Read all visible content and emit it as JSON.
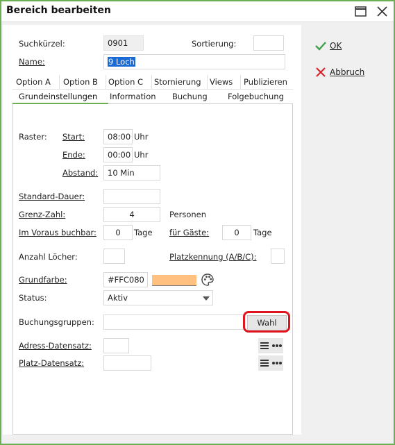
{
  "window": {
    "title": "Bereich bearbeiten"
  },
  "form": {
    "suchkuerzel_label": "Suchkürzel:",
    "suchkuerzel_value": "0901",
    "sortierung_label": "Sortierung:",
    "sortierung_value": "",
    "name_label": "Name:",
    "name_value": "9 Loch"
  },
  "tabs_row1": [
    "Option A",
    "Option B",
    "Option C",
    "Stornierung",
    "Views",
    "Publizieren"
  ],
  "tabs_row2": [
    "Grundeinstellungen",
    "Information",
    "Buchung",
    "Folgebuchung"
  ],
  "active_tab": "Grundeinstellungen",
  "grund": {
    "raster_label": "Raster:",
    "start_label": "Start:",
    "start_value": "08:00",
    "start_unit": "Uhr",
    "ende_label": "Ende:",
    "ende_value": "00:00",
    "ende_unit": "Uhr",
    "abstand_label": "Abstand:",
    "abstand_value": "10 Min",
    "standard_dauer_label": "Standard-Dauer:",
    "standard_dauer_value": "",
    "grenz_zahl_label": "Grenz-Zahl:",
    "grenz_zahl_value": "4",
    "grenz_zahl_unit": "Personen",
    "im_voraus_label": "Im Voraus buchbar:",
    "im_voraus_value": "0",
    "im_voraus_unit": "Tage",
    "fuer_gaeste_label": "für Gäste:",
    "fuer_gaeste_value": "0",
    "fuer_gaeste_unit": "Tage",
    "anzahl_loecher_label": "Anzahl Löcher:",
    "anzahl_loecher_value": "",
    "platzkennung_label": "Platzkennung (A/B/C):",
    "platzkennung_value": "",
    "grundfarbe_label": "Grundfarbe:",
    "grundfarbe_value": "#FFC080",
    "status_label": "Status:",
    "status_value": "Aktiv",
    "buchungsgruppen_label": "Buchungsgruppen:",
    "buchungsgruppen_value": "",
    "wahl_label": "Wahl",
    "adress_label": "Adress-Datensatz:",
    "adress_value": "",
    "platz_label": "Platz-Datensatz:",
    "platz_value": ""
  },
  "actions": {
    "ok": "OK",
    "abbruch": "Abbruch"
  },
  "colors": {
    "accent": "#6cae52",
    "highlight": "#e0141e",
    "swatch": "#FFC080",
    "selection": "#1a6ad6"
  },
  "icons": [
    "maximize-icon",
    "close-icon",
    "palette-icon",
    "chevron-down-icon",
    "list-icon",
    "more-dots-icon",
    "check-icon",
    "x-icon"
  ]
}
